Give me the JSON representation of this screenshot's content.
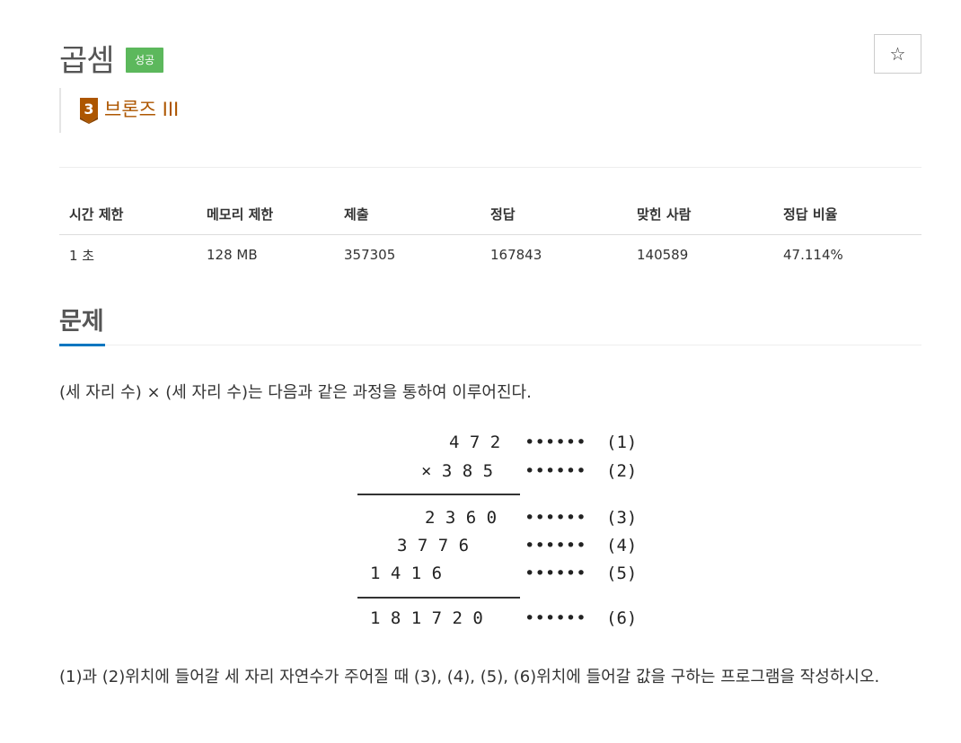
{
  "problem": {
    "title": "곱셈",
    "status_badge": "성공",
    "star_glyph": "☆",
    "tier": {
      "number": "3",
      "label": "브론즈 III",
      "color": "#ad5600"
    }
  },
  "info_table": {
    "headers": [
      "시간 제한",
      "메모리 제한",
      "제출",
      "정답",
      "맞힌 사람",
      "정답 비율"
    ],
    "values": [
      "1 초",
      "128 MB",
      "357305",
      "167843",
      "140589",
      "47.114%"
    ]
  },
  "section": {
    "title": "문제"
  },
  "description": "(세 자리 수) × (세 자리 수)는 다음과 같은 과정을 통하여 이루어진다.",
  "multiplication": {
    "rows": [
      {
        "digits": "4 7 2",
        "dots": "••••••",
        "label": "(1)"
      },
      {
        "digits": "× 3 8 5",
        "dots": "••••••",
        "label": "(2)"
      },
      {
        "digits": "2 3 6 0",
        "dots": "••••••",
        "label": "(3)"
      },
      {
        "digits": "3 7 7 6",
        "dots": "••••••",
        "label": "(4)"
      },
      {
        "digits": "1 4 1 6",
        "dots": "••••••",
        "label": "(5)"
      },
      {
        "digits": "1 8 1 7 2 0",
        "dots": "••••••",
        "label": "(6)"
      }
    ]
  },
  "bottom_text": "(1)과 (2)위치에 들어갈 세 자리 자연수가 주어질 때 (3), (4), (5), (6)위치에 들어갈 값을 구하는 프로그램을 작성하시오.",
  "colors": {
    "badge": "#5cb85c",
    "accent": "#0076c0"
  }
}
